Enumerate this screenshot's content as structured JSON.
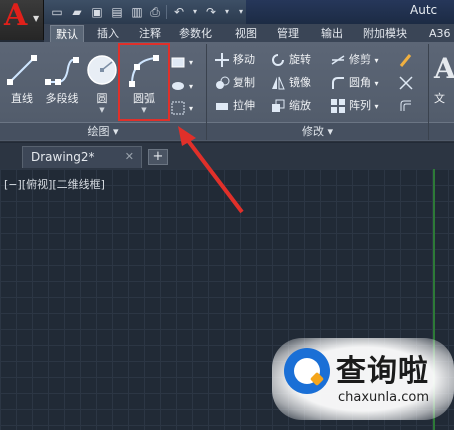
{
  "app": {
    "logo_letter": "A",
    "title_fragment": "Autc"
  },
  "quick_access": {
    "icons": [
      "new-file-icon",
      "open-folder-icon",
      "save-icon",
      "save-as-icon",
      "print-icon",
      "undo-icon",
      "redo-icon"
    ]
  },
  "ribbon_tabs": [
    "默认",
    "插入",
    "注释",
    "参数化",
    "视图",
    "管理",
    "输出",
    "附加模块",
    "A36"
  ],
  "draw_panel": {
    "title": "绘图 ▾",
    "tools": [
      {
        "label": "直线",
        "icon": "line-icon"
      },
      {
        "label": "多段线",
        "icon": "polyline-icon"
      },
      {
        "label": "圆",
        "icon": "circle-icon"
      },
      {
        "label": "圆弧",
        "icon": "arc-icon"
      }
    ]
  },
  "modify_panel": {
    "title": "修改 ▾",
    "tools": [
      {
        "label": "移动",
        "icon": "move-icon"
      },
      {
        "label": "旋转",
        "icon": "rotate-icon"
      },
      {
        "label": "修剪",
        "icon": "trim-icon"
      },
      {
        "label": "复制",
        "icon": "copy-icon"
      },
      {
        "label": "镜像",
        "icon": "mirror-icon"
      },
      {
        "label": "圆角",
        "icon": "fillet-icon"
      },
      {
        "label": "拉伸",
        "icon": "stretch-icon"
      },
      {
        "label": "缩放",
        "icon": "scale-icon"
      },
      {
        "label": "阵列",
        "icon": "array-icon"
      }
    ]
  },
  "text_panel_fragment": "文",
  "file_tab": {
    "label": "Drawing2*",
    "close": "✕",
    "add": "+"
  },
  "viewport_label": "[−][俯视][二维线框]",
  "watermark": {
    "brand": "查询啦",
    "url": "chaxunla.com"
  },
  "colors": {
    "highlight": "#e0302a",
    "arrow": "#e0302a",
    "canvas": "#212a36"
  }
}
